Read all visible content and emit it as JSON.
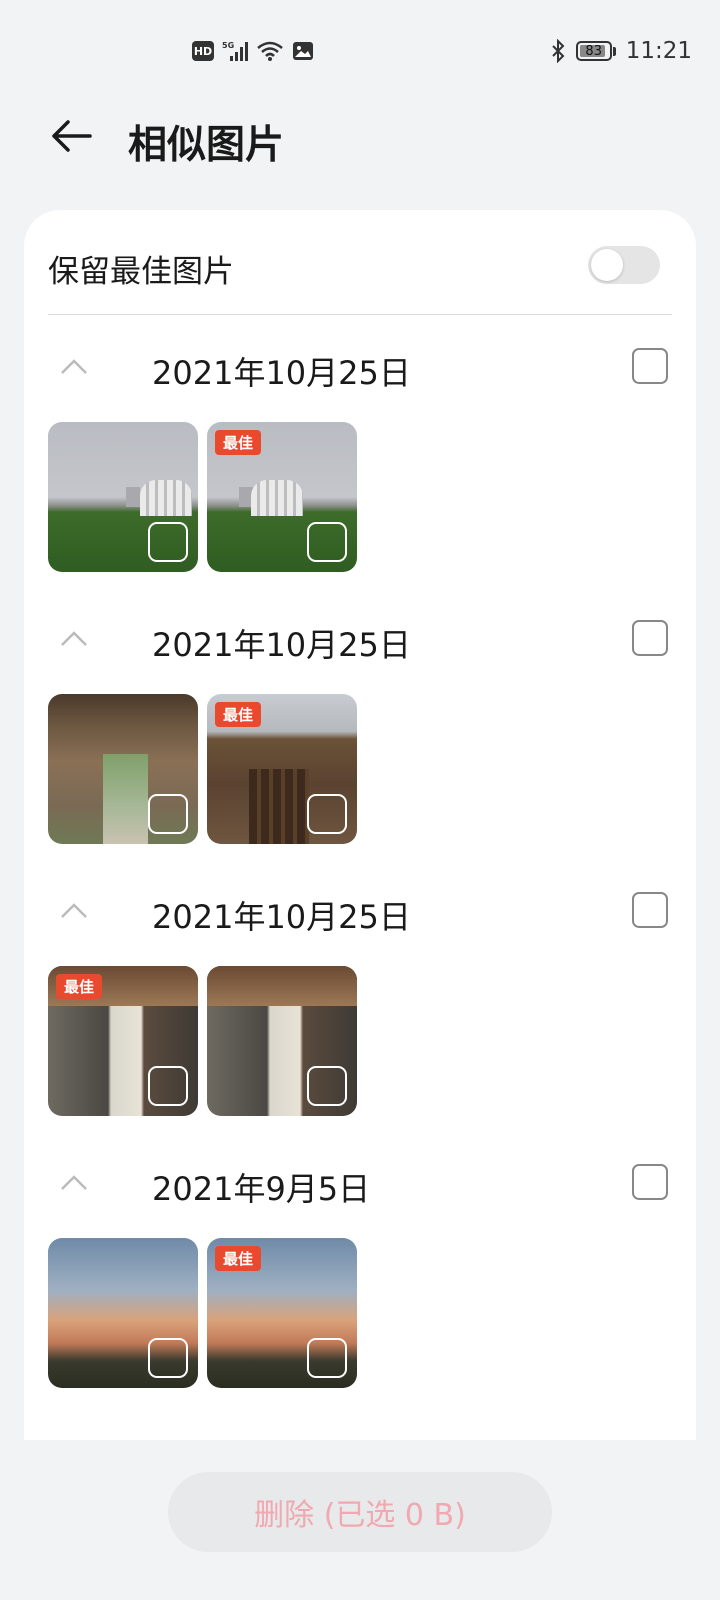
{
  "status_bar": {
    "hd_label": "HD",
    "network": "5G",
    "battery": "83",
    "time": "11:21"
  },
  "header": {
    "title": "相似图片"
  },
  "keep_best": {
    "label": "保留最佳图片",
    "enabled": false
  },
  "groups": [
    {
      "date": "2021年10月25日",
      "photos": [
        {
          "best": false,
          "art": "park"
        },
        {
          "best": true,
          "badge": "最佳",
          "art": "park"
        }
      ]
    },
    {
      "date": "2021年10月25日",
      "photos": [
        {
          "best": false,
          "art": "gate"
        },
        {
          "best": true,
          "badge": "最佳",
          "art": "door"
        }
      ]
    },
    {
      "date": "2021年10月25日",
      "photos": [
        {
          "best": true,
          "badge": "最佳",
          "art": "wall"
        },
        {
          "best": false,
          "art": "wall"
        }
      ]
    },
    {
      "date": "2021年9月5日",
      "photos": [
        {
          "best": false,
          "art": "sky"
        },
        {
          "best": true,
          "badge": "最佳",
          "art": "sky"
        }
      ]
    }
  ],
  "delete_button": {
    "label": "删除 (已选 0 B)"
  },
  "colors": {
    "best_badge": "#e84a2e",
    "delete_text": "#f0a9b0",
    "background": "#f1f3f5"
  }
}
